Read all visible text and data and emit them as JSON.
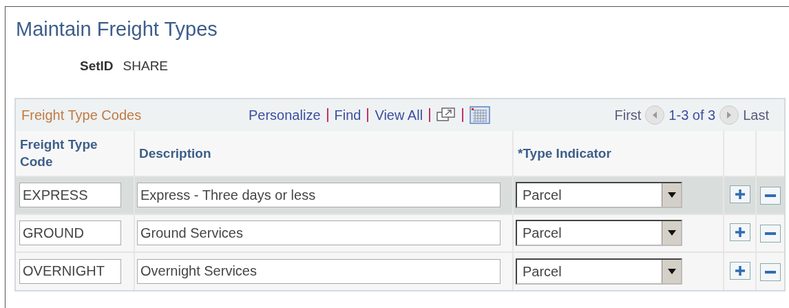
{
  "page": {
    "title": "Maintain Freight Types",
    "setid_label": "SetID",
    "setid_value": "SHARE"
  },
  "grid": {
    "title": "Freight Type Codes",
    "links": [
      "Personalize",
      "Find",
      "View All"
    ],
    "nav": {
      "first": "First",
      "range": "1-3 of 3",
      "last": "Last"
    },
    "columns": [
      "Freight Type Code",
      "Description",
      "*Type Indicator"
    ],
    "rows": [
      {
        "code": "EXPRESS",
        "description": "Express - Three days or less",
        "type": "Parcel",
        "selected": true
      },
      {
        "code": "GROUND",
        "description": "Ground Services",
        "type": "Parcel",
        "selected": false
      },
      {
        "code": "OVERNIGHT",
        "description": "Overnight Services",
        "type": "Parcel",
        "selected": false
      }
    ]
  }
}
